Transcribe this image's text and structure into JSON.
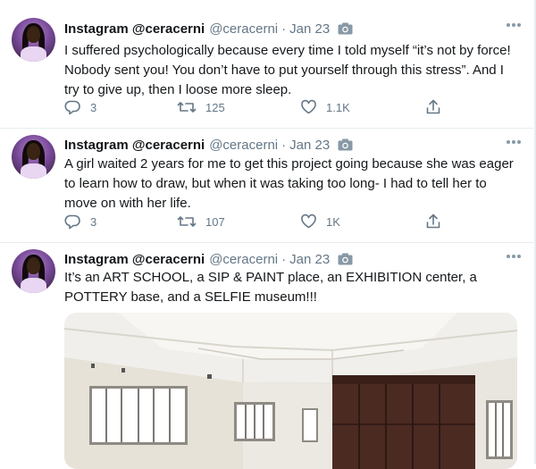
{
  "tweets": [
    {
      "name": "Instagram @ceracerni",
      "handle": "@ceracerni",
      "separator": "·",
      "date": "Jan 23",
      "text": "I suffered psychologically because every time I told myself “it’s not by force! Nobody sent you! You don’t have to put yourself through this stress”. And I try to give up, then I loose more sleep.",
      "replies": "3",
      "retweets": "125",
      "likes": "1.1K"
    },
    {
      "name": "Instagram @ceracerni",
      "handle": "@ceracerni",
      "separator": "·",
      "date": "Jan 23",
      "text": "A girl waited 2 years for me to get this project going because she was eager to learn how to draw, but when it was taking too long- I had to tell her to move on with her life.",
      "replies": "3",
      "retweets": "107",
      "likes": "1K"
    },
    {
      "name": "Instagram @ceracerni",
      "handle": "@ceracerni",
      "separator": "·",
      "date": "Jan 23",
      "text": "It’s an ART SCHOOL, a SIP & PAINT place, an EXHIBITION center, a POTTERY base, and a SELFIE museum!!!"
    }
  ],
  "icons": {
    "camera": "camera-icon",
    "more": "more-icon",
    "reply": "reply-icon",
    "retweet": "retweet-icon",
    "like": "heart-icon",
    "share": "share-icon"
  },
  "colors": {
    "text": "#14171a",
    "secondary": "#657786",
    "divider": "#e6ecf0"
  }
}
